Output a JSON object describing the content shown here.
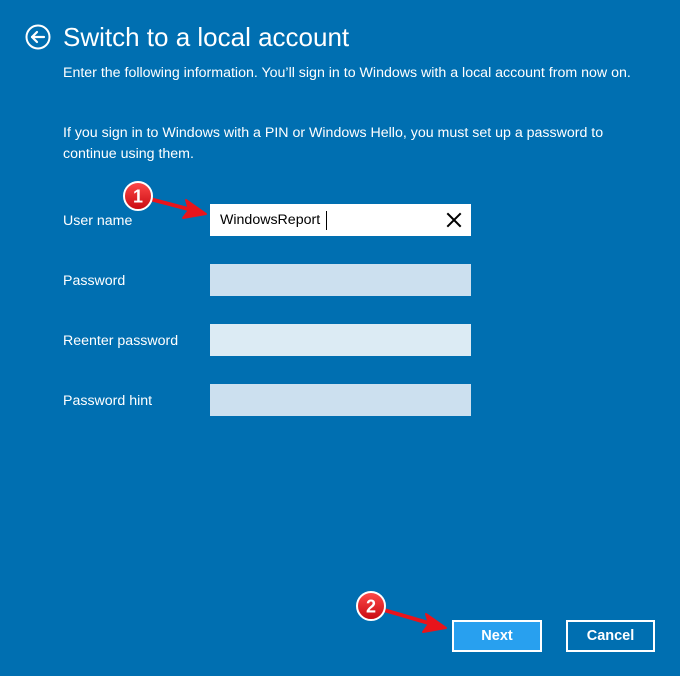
{
  "header": {
    "back_icon": "back-arrow-circle-icon",
    "title": "Switch to a local account"
  },
  "intro": {
    "paragraph1": "Enter the following information. You’ll sign in to Windows with a local account from now on.",
    "paragraph2": "If you sign in to Windows with a PIN or Windows Hello, you must set up a password to continue using them."
  },
  "form": {
    "fields": [
      {
        "label": "User name",
        "value": "WindowsReport",
        "type": "text",
        "clear_icon": "close-x-icon"
      },
      {
        "label": "Password",
        "value": "",
        "type": "password"
      },
      {
        "label": "Reenter password",
        "value": "",
        "type": "password"
      },
      {
        "label": "Password hint",
        "value": "",
        "type": "text"
      }
    ]
  },
  "buttons": {
    "next": "Next",
    "cancel": "Cancel"
  },
  "annotations": [
    {
      "number": "1",
      "target": "User name field"
    },
    {
      "number": "2",
      "target": "Next button"
    }
  ],
  "colors": {
    "background": "#006fb1",
    "next_button": "#28a0ef",
    "empty_field": "#cce0ef",
    "annotation_red": "#e8141b"
  }
}
